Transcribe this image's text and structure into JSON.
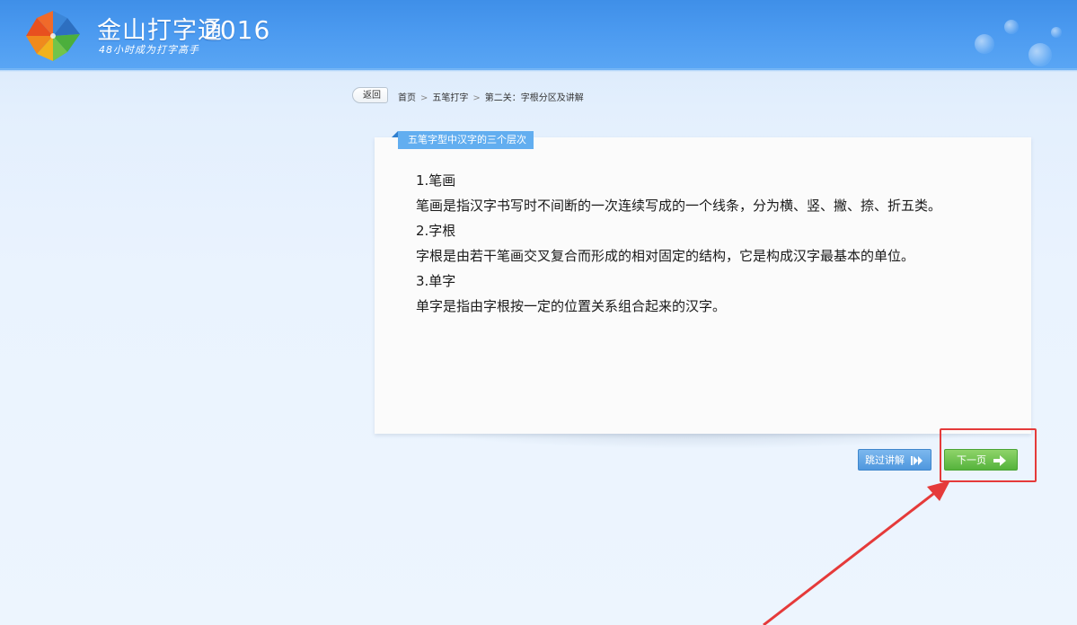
{
  "app": {
    "name": "金山打字通",
    "year": "2016",
    "slogan": "48小时成为打字高手"
  },
  "nav": {
    "back_label": "返回",
    "breadcrumb": [
      "首页",
      "五笔打字",
      "第二关：字根分区及讲解"
    ],
    "separator": ">"
  },
  "card": {
    "tab_title": "五笔字型中汉字的三个层次",
    "lines": [
      "1.笔画",
      "笔画是指汉字书写时不间断的一次连续写成的一个线条，分为横、竖、撇、捺、折五类。",
      "2.字根",
      "字根是由若干笔画交叉复合而形成的相对固定的结构，它是构成汉字最基本的单位。",
      "3.单字",
      "单字是指由字根按一定的位置关系组合起来的汉字。"
    ]
  },
  "buttons": {
    "skip_label": "跳过讲解",
    "next_label": "下一页"
  },
  "icons": {
    "logo": "pinwheel-logo-icon",
    "skip": "fast-forward-icon",
    "next": "arrow-right-icon"
  },
  "colors": {
    "header_blue": "#4b9af0",
    "tab_blue": "#62aef0",
    "skip_blue": "#5fa3e4",
    "next_green": "#66bd47",
    "annotation_red": "#e53a3a"
  }
}
